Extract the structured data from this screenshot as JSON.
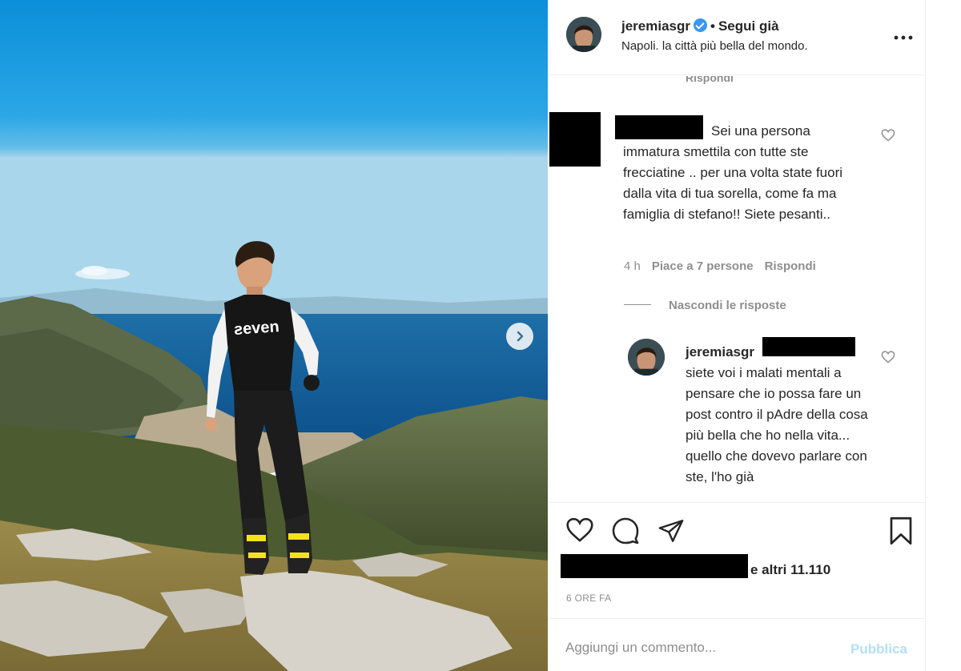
{
  "post": {
    "image_alt": "Photo of a man in motocross gear standing on a mountain above the Amalfi coast"
  },
  "header": {
    "username": "jeremiasgr",
    "separator": "•",
    "follow_label": "Segui già",
    "location": "Napoli. la città più bella del mondo.",
    "more_icon": "more-horizontal-icon",
    "verified_icon": "verified-badge-icon"
  },
  "comments": {
    "faint_reply": "Rispondi",
    "first": {
      "text": "Sei una persona immatura smettila con tutte ste frecciatine .. per una volta state fuori dalla vita di tua sorella, come fa ma famiglia di stefano!! Siete pesanti..",
      "time": "4 h",
      "likes": "Piace a 7 persone",
      "reply": "Rispondi"
    },
    "hide_replies": "Nascondi le risposte",
    "reply": {
      "username": "jeremiasgr",
      "text": "siete voi i malati mentali a pensare che io possa fare un post contro il pAdre della cosa più bella che ho nella vita... quello che dovevo parlare con ste, l'ho già"
    }
  },
  "actions": {
    "like_icon": "heart-icon",
    "comment_icon": "comment-icon",
    "share_icon": "send-icon",
    "save_icon": "bookmark-icon",
    "likes_suffix": "e altri 11.110",
    "time_ago": "6 ORE FA"
  },
  "add_comment": {
    "placeholder": "Aggiungi un commento...",
    "publish_label": "Pubblica"
  },
  "colors": {
    "accent": "#3897f0",
    "publish_disabled": "#b2dffc",
    "muted_text": "#8e8e8e"
  }
}
